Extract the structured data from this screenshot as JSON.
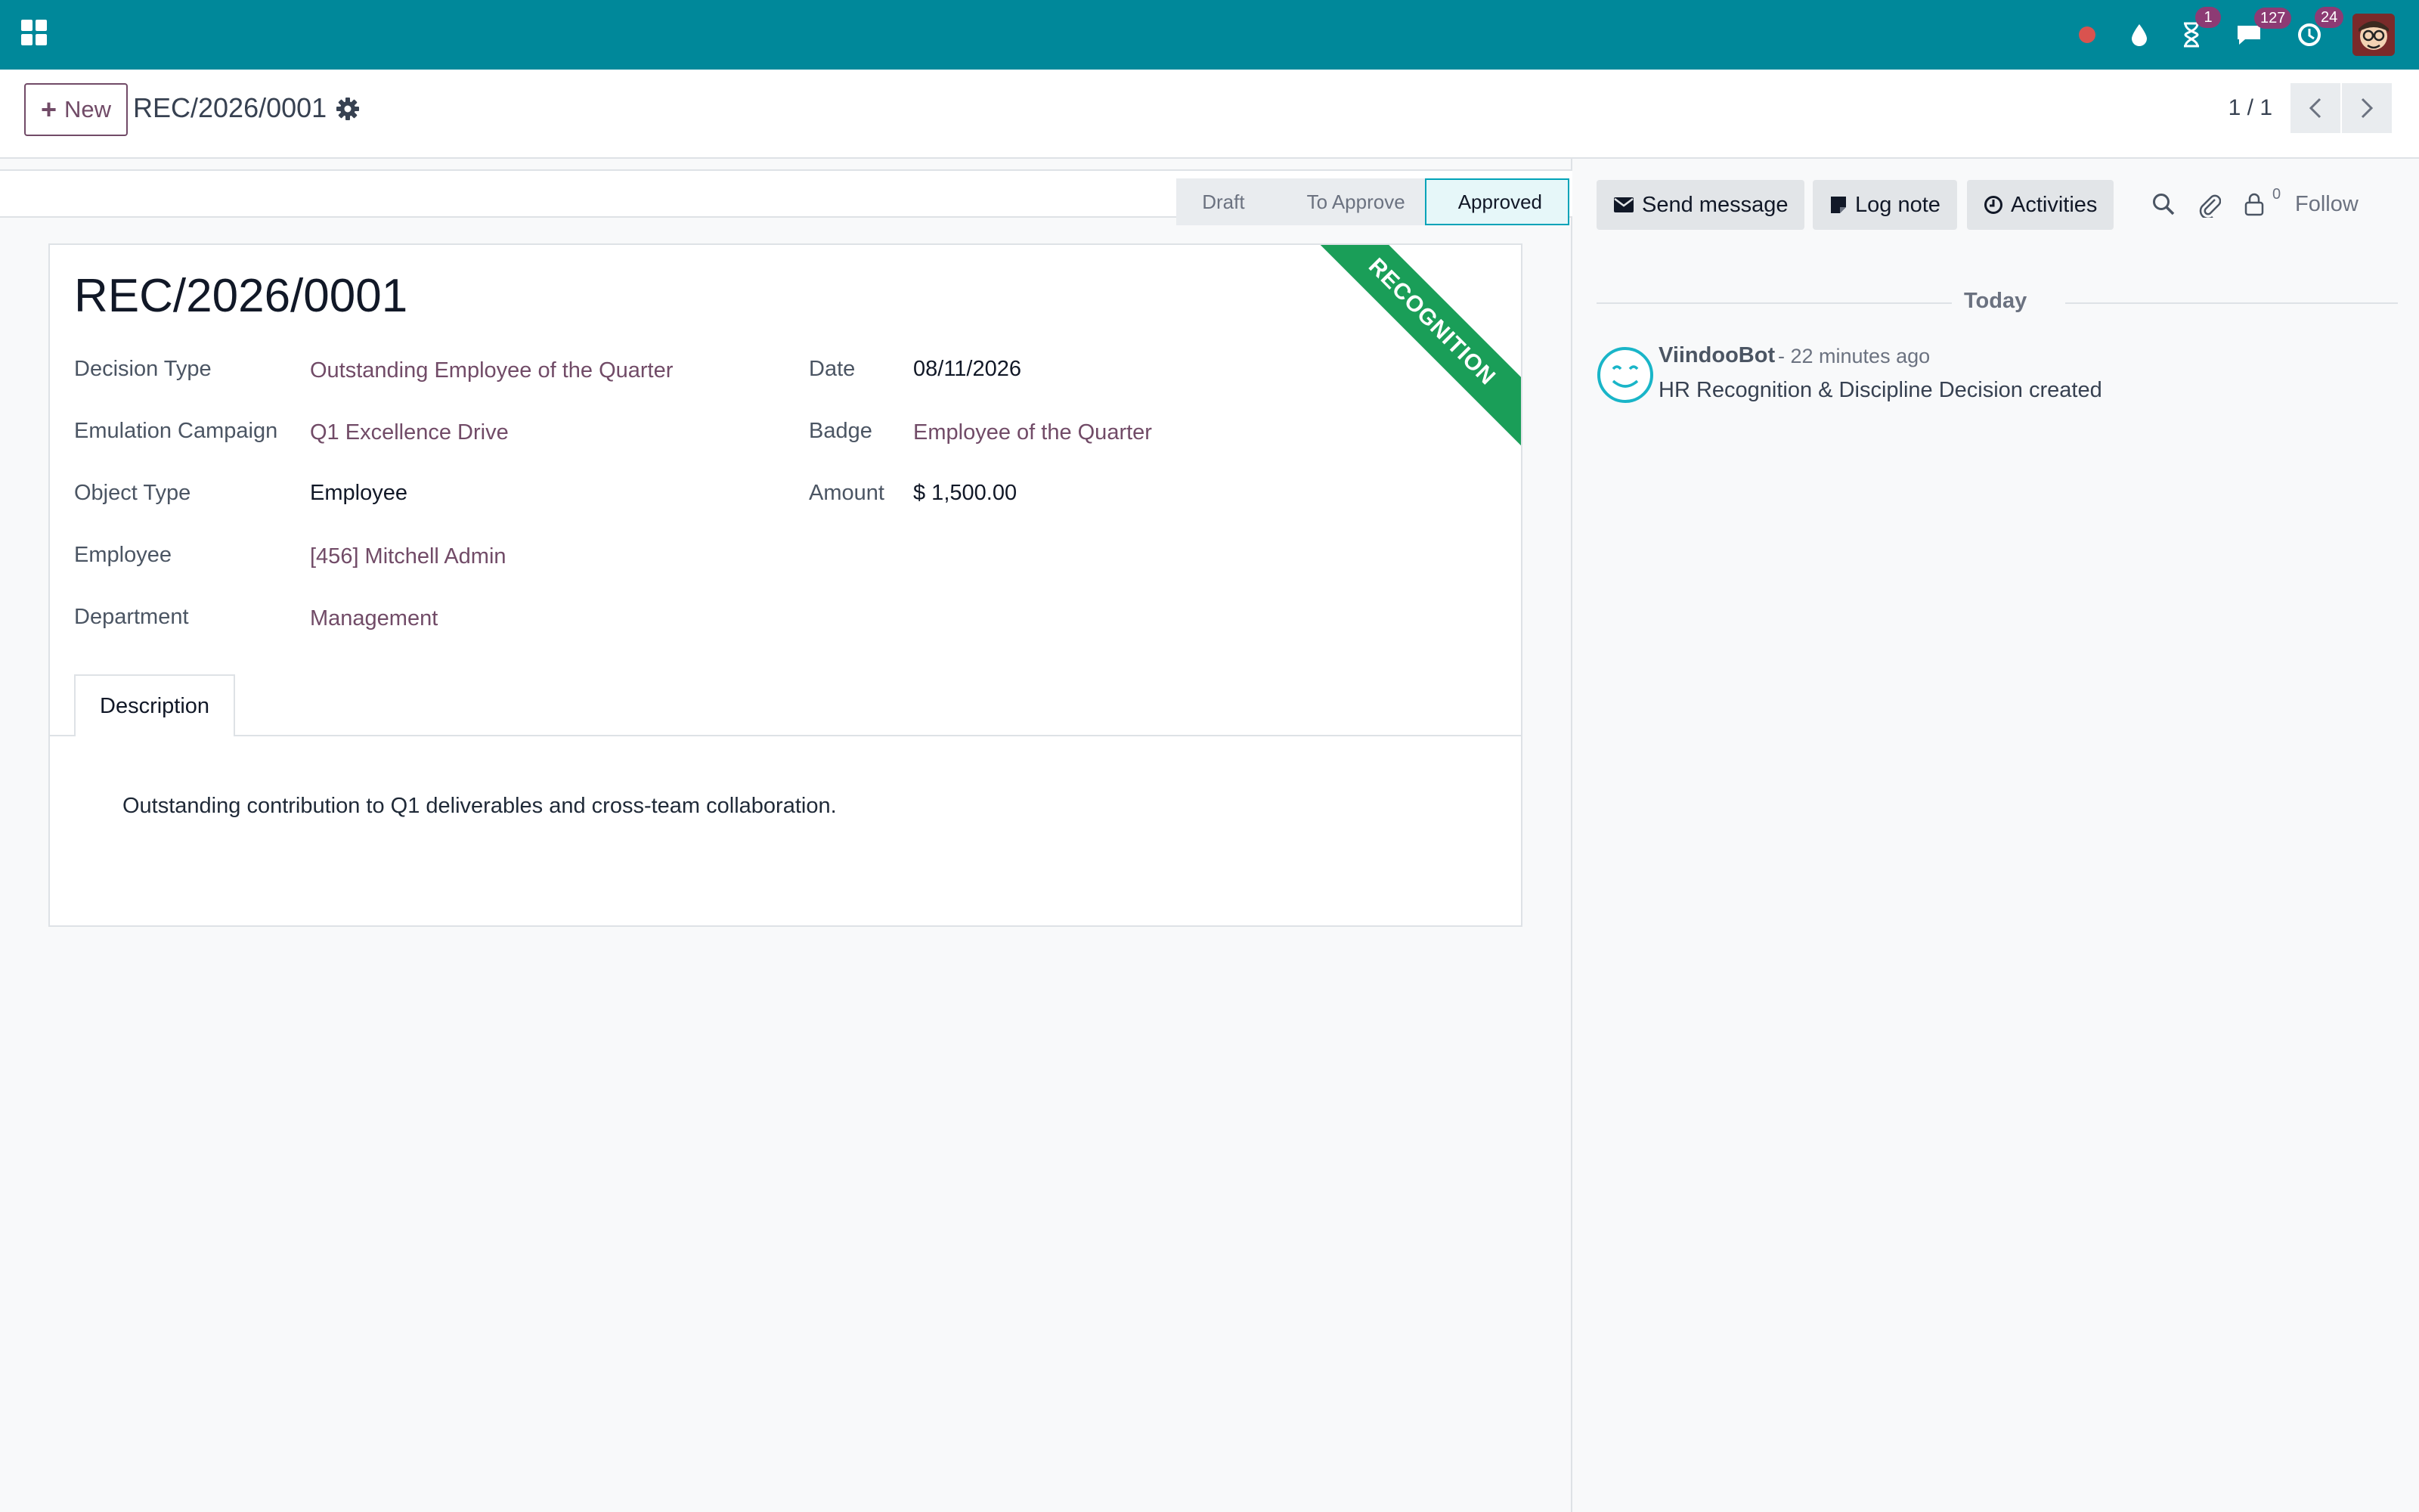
{
  "navbar": {
    "badges": {
      "activities": "1",
      "messages": "127",
      "updates": "24"
    },
    "colors": {
      "bar": "#00889a",
      "badge": "#8d3b74",
      "record_dot": "#d9534f"
    },
    "icons": [
      "apps-grid-icon",
      "record-dot-icon",
      "drop-icon",
      "hourglass-icon",
      "chat-icon",
      "refresh-clock-icon",
      "user-avatar"
    ]
  },
  "control": {
    "new_label": "New",
    "breadcrumb": "REC/2026/0001",
    "pager": "1 / 1"
  },
  "status": {
    "steps": [
      "Draft",
      "To Approve",
      "Approved"
    ],
    "active": "Approved"
  },
  "record": {
    "title": "REC/2026/0001",
    "ribbon": "RECOGNITION",
    "fields": {
      "decision_type": {
        "label": "Decision Type",
        "value": "Outstanding Employee of the Quarter"
      },
      "emulation_campaign": {
        "label": "Emulation Campaign",
        "value": "Q1 Excellence Drive"
      },
      "object_type": {
        "label": "Object Type",
        "value": "Employee"
      },
      "employee": {
        "label": "Employee",
        "value": "[456] Mitchell Admin"
      },
      "department": {
        "label": "Department",
        "value": "Management"
      },
      "date": {
        "label": "Date",
        "value": "08/11/2026"
      },
      "badge": {
        "label": "Badge",
        "value": "Employee of the Quarter"
      },
      "amount": {
        "label": "Amount",
        "value": "$ 1,500.00"
      }
    },
    "tabs": [
      {
        "label": "Description"
      }
    ],
    "description": "Outstanding contribution to Q1 deliverables and cross-team collaboration."
  },
  "chatter": {
    "send_message": "Send message",
    "log_note": "Log note",
    "activities": "Activities",
    "follower_count": "0",
    "follow": "Follow",
    "today": "Today",
    "message": {
      "author": "ViindooBot",
      "time": "- 22 minutes ago",
      "body": "HR Recognition & Discipline Decision created"
    }
  }
}
